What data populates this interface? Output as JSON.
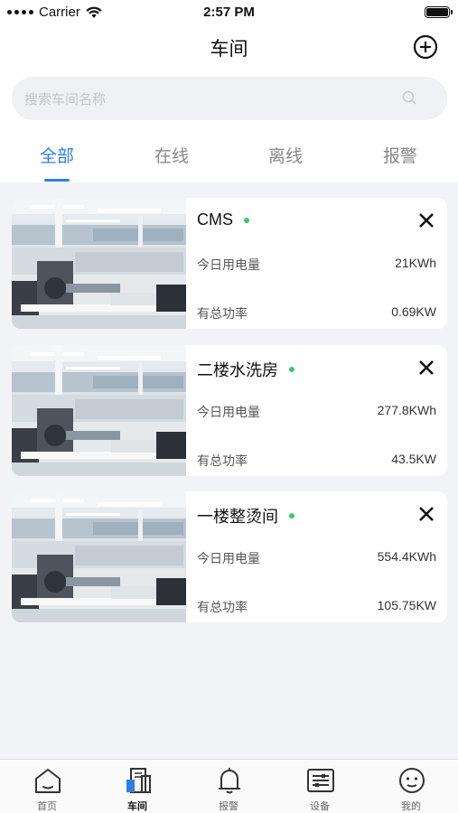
{
  "status_bar": {
    "carrier": "Carrier",
    "time": "2:57 PM"
  },
  "nav": {
    "title": "车间",
    "add_icon": "plus-circle-icon"
  },
  "search": {
    "placeholder": "搜索车间名称",
    "icon": "search-icon"
  },
  "tabs": [
    {
      "label": "全部",
      "active": true
    },
    {
      "label": "在线",
      "active": false
    },
    {
      "label": "离线",
      "active": false
    },
    {
      "label": "报警",
      "active": false
    }
  ],
  "workshops": [
    {
      "name": "CMS",
      "status": "online",
      "energy_label": "今日用电量",
      "energy_value": "21KWh",
      "power_label": "有总功率",
      "power_value": "0.69KW"
    },
    {
      "name": "二楼水洗房",
      "status": "online",
      "energy_label": "今日用电量",
      "energy_value": "277.8KWh",
      "power_label": "有总功率",
      "power_value": "43.5KW"
    },
    {
      "name": "一楼整烫间",
      "status": "online",
      "energy_label": "今日用电量",
      "energy_value": "554.4KWh",
      "power_label": "有总功率",
      "power_value": "105.75KW"
    }
  ],
  "tabbar": [
    {
      "label": "首页",
      "icon": "home-icon",
      "active": false
    },
    {
      "label": "车间",
      "icon": "building-icon",
      "active": true
    },
    {
      "label": "报警",
      "icon": "bell-icon",
      "active": false
    },
    {
      "label": "设备",
      "icon": "device-icon",
      "active": false
    },
    {
      "label": "我的",
      "icon": "profile-icon",
      "active": false
    }
  ],
  "colors": {
    "accent": "#2f7fe6",
    "online": "#3dc76b",
    "background": "#f2f3f7"
  }
}
